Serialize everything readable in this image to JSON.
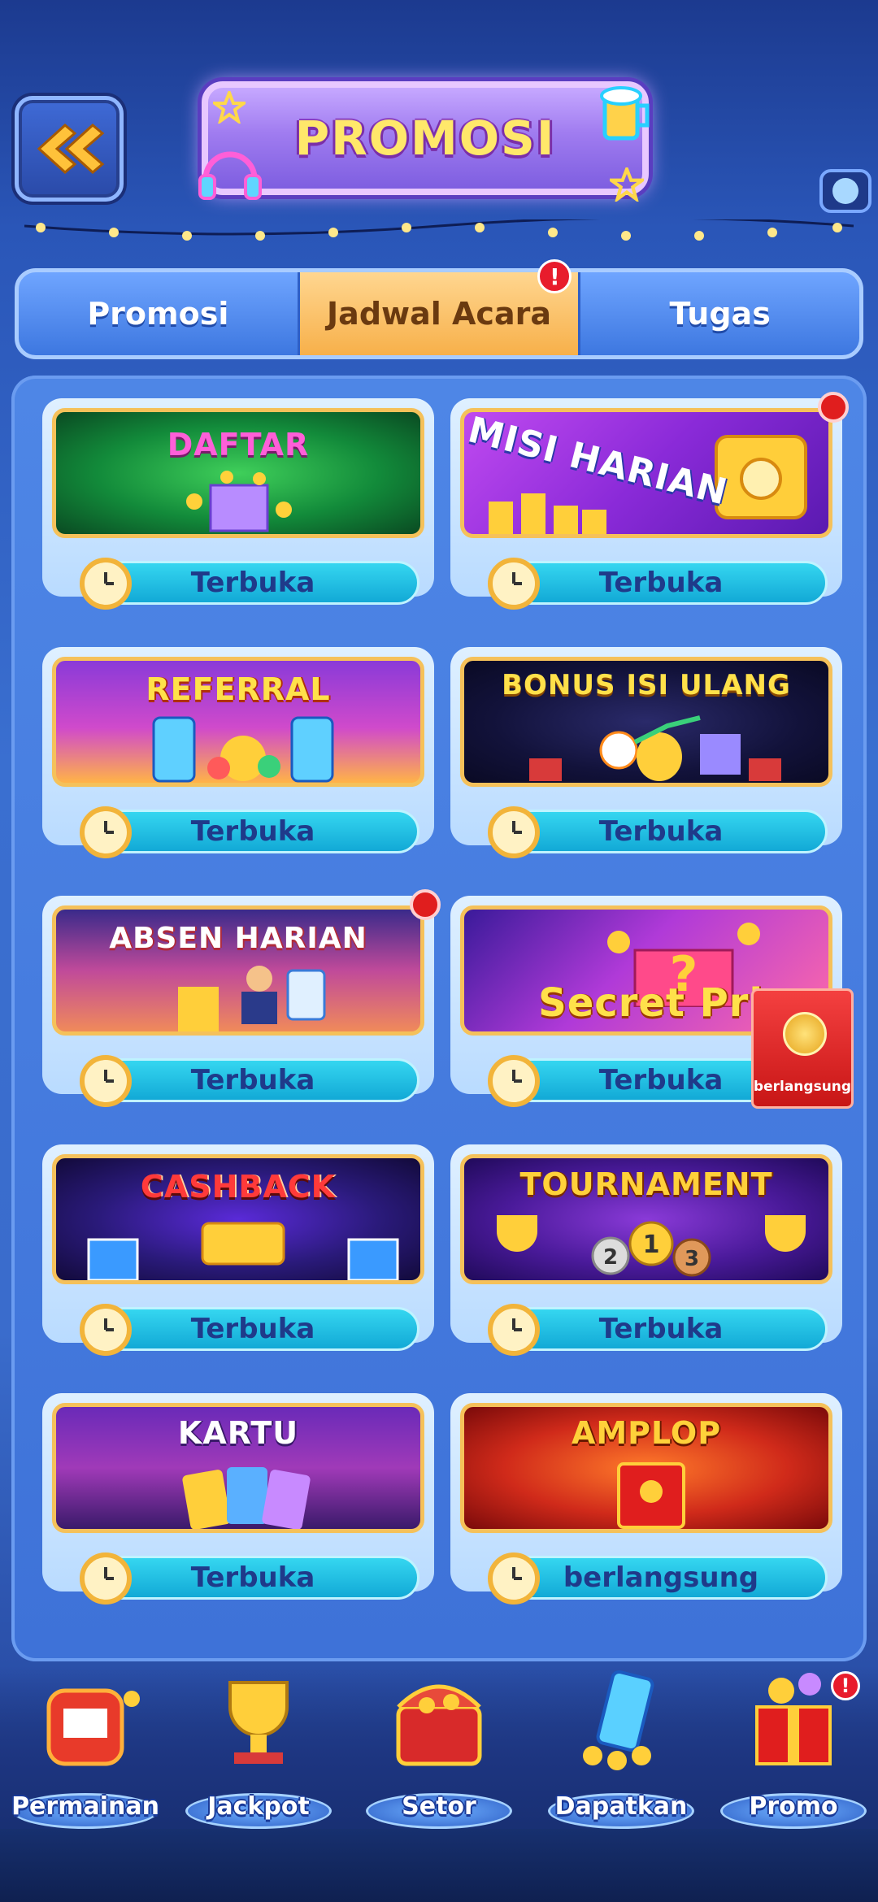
{
  "header": {
    "title": "PROMOSI",
    "back_icon": "double-chevron-left-icon"
  },
  "tabs": [
    {
      "label": "Promosi",
      "active": false
    },
    {
      "label": "Jadwal Acara",
      "active": true,
      "badge": "!"
    },
    {
      "label": "Tugas",
      "active": false
    }
  ],
  "events": [
    {
      "title": "DAFTAR",
      "status": "Terbuka",
      "new_dot": false
    },
    {
      "title": "MISI HARIAN",
      "status": "Terbuka",
      "new_dot": true
    },
    {
      "title": "REFERRAL",
      "status": "Terbuka",
      "new_dot": false
    },
    {
      "title": "BONUS ISI ULANG",
      "status": "Terbuka",
      "new_dot": false
    },
    {
      "title": "ABSEN HARIAN",
      "status": "Terbuka",
      "new_dot": true
    },
    {
      "title": "Secret Priz",
      "status": "Terbuka",
      "new_dot": false
    },
    {
      "title": "CASHBACK",
      "status": "Terbuka",
      "new_dot": false
    },
    {
      "title": "TOURNAMENT",
      "status": "Terbuka",
      "new_dot": false
    },
    {
      "title": "KARTU",
      "status": "Terbuka",
      "new_dot": false
    },
    {
      "title": "AMPLOP",
      "status": "berlangsung",
      "new_dot": false
    }
  ],
  "floating_envelope": {
    "label": "berlangsung"
  },
  "bottom_nav": [
    {
      "label": "Permainan",
      "icon": "slot-machine-icon"
    },
    {
      "label": "Jackpot",
      "icon": "trophy-icon"
    },
    {
      "label": "Setor",
      "icon": "treasure-chest-icon"
    },
    {
      "label": "Dapatkan",
      "icon": "phone-coins-icon"
    },
    {
      "label": "Promo",
      "icon": "gift-box-icon",
      "badge": "!"
    }
  ],
  "colors": {
    "accent": "#f7b04a",
    "status_bar": "#12a9d6",
    "card_border": "#f5c15a",
    "badge_red": "#e81c2c"
  }
}
